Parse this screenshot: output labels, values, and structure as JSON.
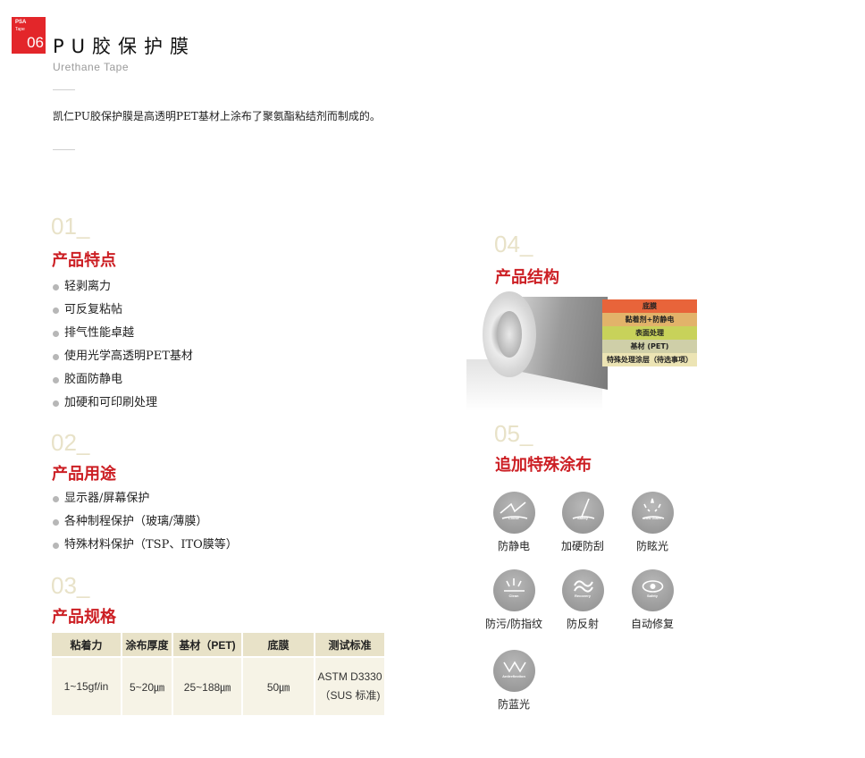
{
  "header": {
    "badge_line1": "PSA",
    "badge_line2": "Tape",
    "badge_number": "06",
    "title": "PU胶保护膜",
    "subtitle": "Urethane Tape",
    "intro": "凯仁PU胶保护膜是高透明PET基材上涂布了聚氨酯粘结剂而制成的。"
  },
  "features": {
    "number": "01_",
    "heading": "产品特点",
    "items": [
      "轻剥离力",
      "可反复粘帖",
      "排气性能卓越",
      "使用光学高透明PET基材",
      "胶面防静电",
      "加硬和可印刷处理"
    ]
  },
  "uses": {
    "number": "02_",
    "heading": "产品用途",
    "items": [
      "显示器/屏幕保护",
      "各种制程保护（玻璃/薄膜）",
      "特殊材料保护（TSP、ITO膜等）"
    ]
  },
  "specs": {
    "number": "03_",
    "heading": "产品规格",
    "headers": [
      "粘着力",
      "涂布厚度",
      "基材（PET)",
      "底膜",
      "测试标准"
    ],
    "row": [
      "1~15gf/in",
      "5~20㎛",
      "25~188㎛",
      "50㎛",
      "ASTM D3330"
    ],
    "row_note": "（SUS 标准)"
  },
  "structure": {
    "number": "04_",
    "heading": "产品结构",
    "layers": [
      {
        "label": "底膜",
        "color": "#e8643a"
      },
      {
        "label": "黏着剂+防静电",
        "color": "#e2b36a"
      },
      {
        "label": "表面处理",
        "color": "#c8d25a"
      },
      {
        "label": "基材 (PET)",
        "color": "#cfcfa8"
      },
      {
        "label": "特殊处理涂层（待选事项）",
        "color": "#ece4b4"
      }
    ]
  },
  "coatings": {
    "number": "05_",
    "heading": "追加特殊涂布",
    "items": [
      {
        "label": "防静电",
        "tag": "Loose",
        "icon": "antistatic-icon"
      },
      {
        "label": "加硬防刮",
        "tag": "Safety",
        "icon": "hardcoat-icon"
      },
      {
        "label": "防眩光",
        "tag": "Low Glare",
        "icon": "antiglare-icon"
      },
      {
        "label": "防污/防指纹",
        "tag": "Clean",
        "icon": "antifouling-icon"
      },
      {
        "label": "防反射",
        "tag": "Recovery",
        "icon": "antireflection-icon"
      },
      {
        "label": "自动修复",
        "tag": "Safety",
        "icon": "selfhealing-icon"
      },
      {
        "label": "防蓝光",
        "tag": "Antireflection",
        "icon": "antiblue-icon"
      }
    ]
  }
}
